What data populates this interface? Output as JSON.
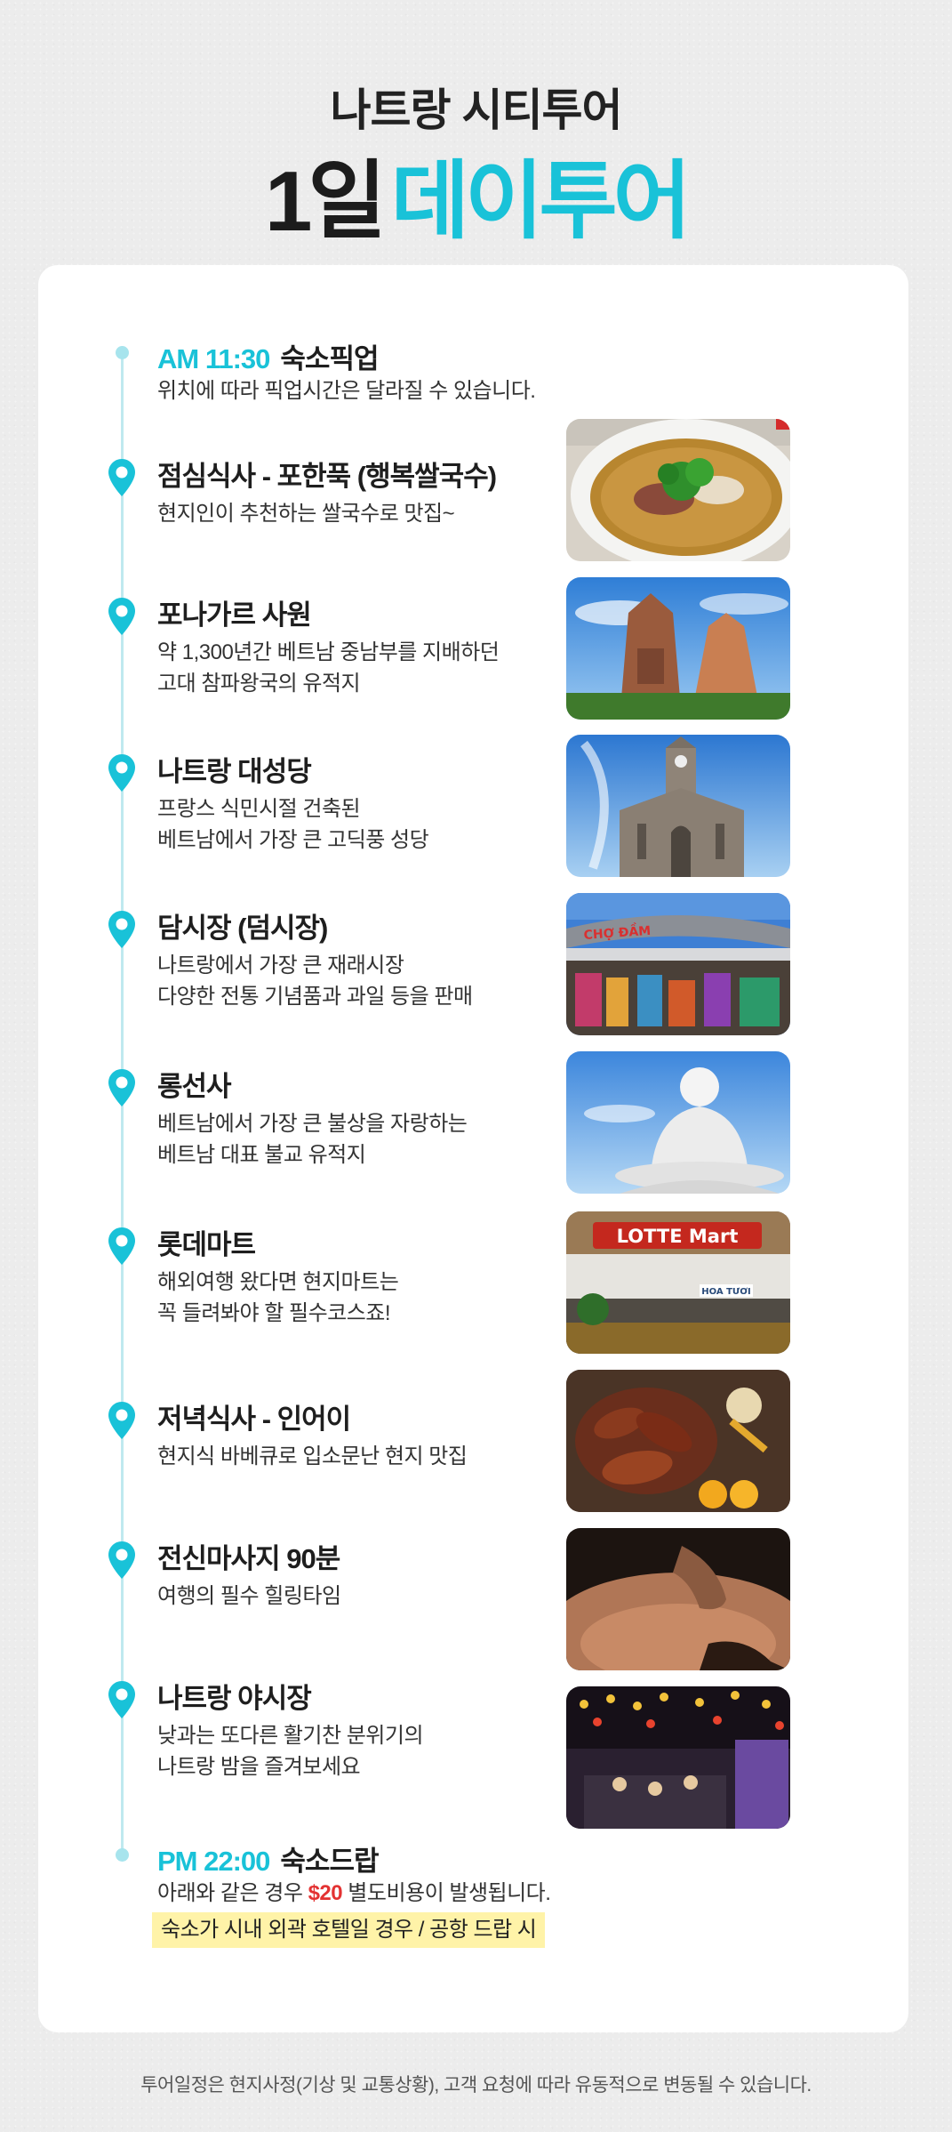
{
  "header": {
    "subtitle": "나트랑 시티투어",
    "title_main": "1일",
    "title_accent": "데이투어"
  },
  "colors": {
    "accent": "#19c2d8",
    "price": "#e33232",
    "highlight_bg": "#fff3a8",
    "timeline": "#bfe9ef"
  },
  "start": {
    "time": "AM 11:30",
    "label": "숙소픽업",
    "description": "위치에 따라 픽업시간은 달라질 수 있습니다."
  },
  "items": [
    {
      "title": "점심식사 - 포한푹 (행복쌀국수)",
      "description": "현지인이 추천하는 쌀국수로 맛집~",
      "icon": "location-pin-icon",
      "photo": "pho-noodle-soup"
    },
    {
      "title": "포나가르 사원",
      "description": "약 1,300년간 베트남 중남부를 지배하던\n고대 참파왕국의 유적지",
      "icon": "location-pin-icon",
      "photo": "ponagar-tower"
    },
    {
      "title": "나트랑 대성당",
      "description": "프랑스 식민시절 건축된\n베트남에서 가장 큰 고딕풍 성당",
      "icon": "location-pin-icon",
      "photo": "nha-trang-cathedral"
    },
    {
      "title": "담시장 (덤시장)",
      "description": "나트랑에서 가장 큰 재래시장\n다양한 전통 기념품과 과일 등을 판매",
      "icon": "location-pin-icon",
      "photo": "dam-market"
    },
    {
      "title": "롱선사",
      "description": "베트남에서 가장 큰 불상을 자랑하는\n베트남 대표 불교 유적지",
      "icon": "location-pin-icon",
      "photo": "long-son-buddha"
    },
    {
      "title": "롯데마트",
      "description": "해외여행 왔다면 현지마트는\n꼭 들려봐야 할 필수코스죠!",
      "icon": "location-pin-icon",
      "photo": "lotte-mart",
      "photo_sign": "LOTTE Mart",
      "photo_sign2": "HOA TƯƠI"
    },
    {
      "title": "저녁식사 - 인어이",
      "description": "현지식 바베큐로 입소문난 현지 맛집",
      "icon": "location-pin-icon",
      "photo": "bbq-dinner"
    },
    {
      "title": "전신마사지 90분",
      "description": "여행의 필수 힐링타임",
      "icon": "location-pin-icon",
      "photo": "massage"
    },
    {
      "title": "나트랑 야시장",
      "description": "낮과는 또다른 활기찬 분위기의\n나트랑 밤을 즐겨보세요",
      "icon": "location-pin-icon",
      "photo": "night-market"
    }
  ],
  "end": {
    "time": "PM 22:00",
    "label": "숙소드랍",
    "desc_before": "아래와 같은 경우 ",
    "price": "$20",
    "desc_after": " 별도비용이 발생됩니다.",
    "highlight": "숙소가 시내 외곽 호텔일 경우 / 공항 드랍 시"
  },
  "footnote": "투어일정은 현지사정(기상 및 교통상황), 고객 요청에 따라 유동적으로 변동될 수 있습니다."
}
